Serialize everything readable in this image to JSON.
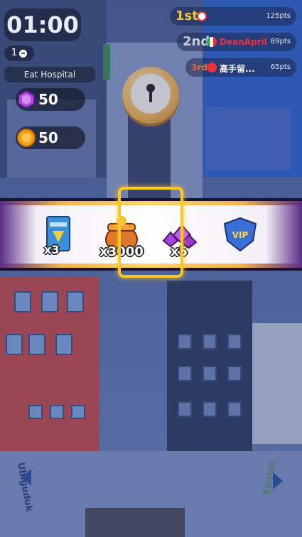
{
  "hud": {
    "timer": "01:00",
    "chat_count": "1",
    "location": "Eat Hospital",
    "gems": "50",
    "coins": "50"
  },
  "leaderboard": [
    {
      "position": "1st",
      "name": "",
      "points": "125pts",
      "flag_color": "#e8313f"
    },
    {
      "position": "2nd",
      "name": "DeanApril",
      "points": "89pts",
      "flag_color": "#2fa84a"
    },
    {
      "position": "3rd",
      "name": "高手留...",
      "points": "65pts",
      "flag_color": "#e8313f"
    }
  ],
  "roulette": {
    "items": [
      {
        "icon": "ticket-icon",
        "label": "x3"
      },
      {
        "icon": "treasure-pot-icon",
        "label": "x3000"
      },
      {
        "icon": "gem-pile-icon",
        "label": "x5"
      },
      {
        "icon": "vip-shield-icon",
        "label": ""
      }
    ]
  },
  "street_labels": {
    "left": "Ubiguduk",
    "right": "Ejcrow"
  },
  "colors": {
    "selector": "#ffc81e",
    "strip_edge": "#5b2d86",
    "water": "#2f63c8"
  }
}
